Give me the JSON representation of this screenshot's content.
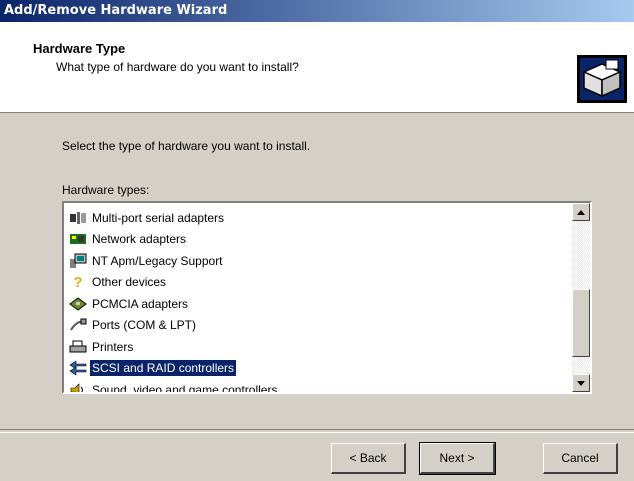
{
  "window": {
    "title": "Add/Remove Hardware Wizard"
  },
  "header": {
    "title": "Hardware Type",
    "subtitle": "What type of hardware do you want to install?",
    "icon": "hardware-box-icon"
  },
  "main": {
    "instruction": "Select the type of hardware you want to install.",
    "list_label": "Hardware types:",
    "items": [
      {
        "label": "Multi-port serial adapters",
        "icon": "serial-adapter-icon",
        "selected": false
      },
      {
        "label": "Network adapters",
        "icon": "network-adapter-icon",
        "selected": false
      },
      {
        "label": "NT Apm/Legacy Support",
        "icon": "computer-icon",
        "selected": false
      },
      {
        "label": "Other devices",
        "icon": "question-mark-icon",
        "selected": false
      },
      {
        "label": "PCMCIA adapters",
        "icon": "pcmcia-card-icon",
        "selected": false
      },
      {
        "label": "Ports (COM & LPT)",
        "icon": "port-cable-icon",
        "selected": false
      },
      {
        "label": "Printers",
        "icon": "printer-icon",
        "selected": false
      },
      {
        "label": "SCSI and RAID controllers",
        "icon": "scsi-arrows-icon",
        "selected": true
      },
      {
        "label": "Sound, video and game controllers",
        "icon": "sound-icon",
        "selected": false
      }
    ]
  },
  "buttons": {
    "back": "< Back",
    "next": "Next >",
    "cancel": "Cancel"
  },
  "colors": {
    "title_bar": "#0a246a",
    "selection": "#0a246a",
    "face": "#d4d0c8"
  }
}
